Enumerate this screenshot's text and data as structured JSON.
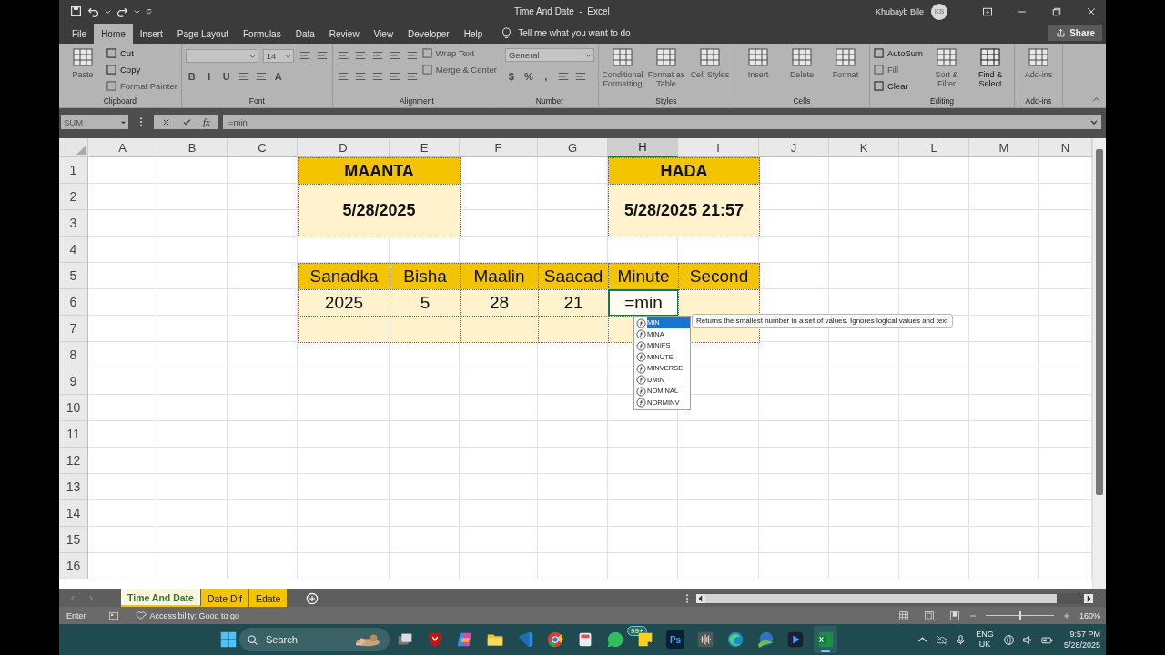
{
  "window": {
    "title": "Time And Date  -  Excel",
    "user": "Khubayb Bile",
    "avatar": "KB"
  },
  "menu_tabs": [
    {
      "label": "File",
      "selected": false
    },
    {
      "label": "Home",
      "selected": true
    },
    {
      "label": "Insert",
      "selected": false
    },
    {
      "label": "Page Layout",
      "selected": false
    },
    {
      "label": "Formulas",
      "selected": false
    },
    {
      "label": "Data",
      "selected": false
    },
    {
      "label": "Review",
      "selected": false
    },
    {
      "label": "View",
      "selected": false
    },
    {
      "label": "Developer",
      "selected": false
    },
    {
      "label": "Help",
      "selected": false
    }
  ],
  "tell_me": "Tell me what you want to do",
  "share": "Share",
  "ribbon": {
    "groups": [
      {
        "label": "Clipboard",
        "columns": [
          [
            {
              "kind": "large",
              "label": "Paste",
              "disabled": true
            }
          ],
          [
            {
              "kind": "small",
              "label": "Cut",
              "disabled": false
            },
            {
              "kind": "small",
              "label": "Copy",
              "disabled": false
            },
            {
              "kind": "small",
              "label": "Format Painter",
              "disabled": true
            }
          ]
        ]
      },
      {
        "label": "Font",
        "columns": [
          [
            {
              "kind": "row",
              "items": [
                {
                  "kind": "fontbox",
                  "disabled": true
                },
                {
                  "kind": "sizebox",
                  "label": "14",
                  "disabled": true
                },
                {
                  "kind": "tool",
                  "disabled": true
                },
                {
                  "kind": "tool",
                  "disabled": true
                }
              ]
            },
            {
              "kind": "row",
              "items": [
                {
                  "kind": "glyph",
                  "label": "B",
                  "disabled": true
                },
                {
                  "kind": "glyph",
                  "label": "I",
                  "disabled": true
                },
                {
                  "kind": "glyph",
                  "label": "U",
                  "disabled": true
                },
                {
                  "kind": "tool",
                  "disabled": true
                },
                {
                  "kind": "tool",
                  "disabled": true
                },
                {
                  "kind": "glyph",
                  "label": "A",
                  "disabled": true
                }
              ]
            }
          ]
        ]
      },
      {
        "label": "Alignment",
        "columns": [
          [
            {
              "kind": "row",
              "items": [
                {
                  "kind": "tool",
                  "disabled": true
                },
                {
                  "kind": "tool",
                  "disabled": true
                },
                {
                  "kind": "tool",
                  "disabled": true
                },
                {
                  "kind": "tool",
                  "disabled": true
                },
                {
                  "kind": "tool",
                  "disabled": true
                }
              ]
            },
            {
              "kind": "row",
              "items": [
                {
                  "kind": "tool",
                  "disabled": true
                },
                {
                  "kind": "tool",
                  "disabled": true
                },
                {
                  "kind": "tool",
                  "disabled": true
                },
                {
                  "kind": "tool",
                  "disabled": true
                },
                {
                  "kind": "tool",
                  "disabled": true
                }
              ]
            }
          ],
          [
            {
              "kind": "small",
              "label": "Wrap Text",
              "disabled": true
            },
            {
              "kind": "small",
              "label": "Merge & Center",
              "disabled": true
            }
          ]
        ]
      },
      {
        "label": "Number",
        "columns": [
          [
            {
              "kind": "formatbox",
              "label": "General",
              "disabled": true
            },
            {
              "kind": "row",
              "items": [
                {
                  "kind": "glyph",
                  "label": "$",
                  "disabled": true
                },
                {
                  "kind": "glyph",
                  "label": "%",
                  "disabled": true
                },
                {
                  "kind": "glyph",
                  "label": ",",
                  "disabled": true
                },
                {
                  "kind": "tool",
                  "disabled": true
                },
                {
                  "kind": "tool",
                  "disabled": true
                }
              ]
            }
          ]
        ]
      },
      {
        "label": "Styles",
        "columns": [
          [
            {
              "kind": "large",
              "label": "Conditional Formatting",
              "disabled": true
            }
          ],
          [
            {
              "kind": "large",
              "label": "Format as Table",
              "disabled": true
            }
          ],
          [
            {
              "kind": "large",
              "label": "Cell Styles",
              "disabled": true
            }
          ]
        ]
      },
      {
        "label": "Cells",
        "columns": [
          [
            {
              "kind": "large",
              "label": "Insert",
              "disabled": true
            }
          ],
          [
            {
              "kind": "large",
              "label": "Delete",
              "disabled": true
            }
          ],
          [
            {
              "kind": "large",
              "label": "Format",
              "disabled": true
            }
          ]
        ]
      },
      {
        "label": "Editing",
        "columns": [
          [
            {
              "kind": "small",
              "label": "AutoSum",
              "disabled": false
            },
            {
              "kind": "small",
              "label": "Fill",
              "disabled": true
            },
            {
              "kind": "small",
              "label": "Clear",
              "disabled": false
            }
          ],
          [
            {
              "kind": "large",
              "label": "Sort & Filter",
              "disabled": true
            }
          ],
          [
            {
              "kind": "large",
              "label": "Find & Select",
              "disabled": false
            }
          ]
        ]
      },
      {
        "label": "Add-ins",
        "columns": [
          [
            {
              "kind": "large",
              "label": "Add-ins",
              "disabled": true
            }
          ]
        ]
      }
    ]
  },
  "formula_bar": {
    "name_box": "SUM",
    "function_label": "fx",
    "formula": "=min"
  },
  "sheet": {
    "columns": [
      {
        "label": "A",
        "selected": false
      },
      {
        "label": "B",
        "selected": false
      },
      {
        "label": "C",
        "selected": false
      },
      {
        "label": "D",
        "selected": false
      },
      {
        "label": "E",
        "selected": false
      },
      {
        "label": "F",
        "selected": false
      },
      {
        "label": "G",
        "selected": false
      },
      {
        "label": "H",
        "selected": true
      },
      {
        "label": "I",
        "selected": false
      },
      {
        "label": "J",
        "selected": false
      },
      {
        "label": "K",
        "selected": false
      },
      {
        "label": "L",
        "selected": false
      },
      {
        "label": "M",
        "selected": false
      },
      {
        "label": "N",
        "selected": false
      }
    ],
    "rows": [
      {
        "label": "1",
        "cells": [
          {
            "kind": "empty"
          },
          {
            "kind": "empty"
          },
          {
            "kind": "empty"
          },
          {
            "kind": "header",
            "bold": true,
            "text": "MAANTA",
            "editing": false
          },
          {
            "kind": "covered"
          },
          {
            "kind": "empty"
          },
          {
            "kind": "empty"
          },
          {
            "kind": "header",
            "bold": true,
            "text": "HADA",
            "editing": false
          },
          {
            "kind": "covered"
          }
        ]
      },
      {
        "label": "2",
        "cells": [
          {
            "kind": "empty"
          },
          {
            "kind": "empty"
          },
          {
            "kind": "empty"
          },
          {
            "kind": "value",
            "bold": true,
            "text": "5/28/2025",
            "editing": false
          },
          {
            "kind": "covered"
          },
          {
            "kind": "empty"
          },
          {
            "kind": "empty"
          },
          {
            "kind": "value",
            "bold": true,
            "text": "5/28/2025 21:57",
            "editing": false
          },
          {
            "kind": "covered"
          }
        ]
      },
      {
        "label": "3",
        "cells": [
          {
            "kind": "empty"
          },
          {
            "kind": "empty"
          },
          {
            "kind": "empty"
          },
          {
            "kind": "covered"
          },
          {
            "kind": "covered"
          },
          {
            "kind": "empty"
          },
          {
            "kind": "empty"
          },
          {
            "kind": "covered"
          },
          {
            "kind": "covered"
          }
        ]
      },
      {
        "label": "4"
      },
      {
        "label": "5",
        "cells": [
          {
            "kind": "empty"
          },
          {
            "kind": "empty"
          },
          {
            "kind": "empty"
          },
          {
            "kind": "header",
            "bold": false,
            "text": "Sanadka",
            "editing": false
          },
          {
            "kind": "header",
            "bold": false,
            "text": "Bisha",
            "editing": false
          },
          {
            "kind": "header",
            "bold": false,
            "text": "Maalin",
            "editing": false
          },
          {
            "kind": "header",
            "bold": false,
            "text": "Saacad",
            "editing": false
          },
          {
            "kind": "header",
            "bold": false,
            "text": "Minute",
            "editing": false
          },
          {
            "kind": "header",
            "bold": false,
            "text": "Second",
            "editing": false
          }
        ]
      },
      {
        "label": "6",
        "cells": [
          {
            "kind": "empty"
          },
          {
            "kind": "empty"
          },
          {
            "kind": "empty"
          },
          {
            "kind": "value",
            "bold": false,
            "text": "2025",
            "editing": false
          },
          {
            "kind": "value",
            "bold": false,
            "text": "5",
            "editing": false
          },
          {
            "kind": "value",
            "bold": false,
            "text": "28",
            "editing": false
          },
          {
            "kind": "value",
            "bold": false,
            "text": "21",
            "editing": false
          },
          {
            "kind": "value",
            "bold": false,
            "text": "=min",
            "editing": true
          },
          {
            "kind": "value",
            "editing": false
          }
        ]
      },
      {
        "label": "7",
        "cells": [
          {
            "kind": "empty"
          },
          {
            "kind": "empty"
          },
          {
            "kind": "empty"
          },
          {
            "kind": "value",
            "editing": false
          },
          {
            "kind": "value",
            "editing": false
          },
          {
            "kind": "value",
            "editing": false
          },
          {
            "kind": "value",
            "editing": false
          },
          {
            "kind": "value",
            "editing": false
          },
          {
            "kind": "value",
            "editing": false
          }
        ]
      },
      {
        "label": "8"
      },
      {
        "label": "9"
      },
      {
        "label": "10"
      },
      {
        "label": "11"
      },
      {
        "label": "12"
      },
      {
        "label": "13"
      },
      {
        "label": "14"
      },
      {
        "label": "15"
      },
      {
        "label": "16"
      }
    ]
  },
  "autocomplete": {
    "items": [
      {
        "label": "MIN",
        "selected": true
      },
      {
        "label": "MINA",
        "selected": false
      },
      {
        "label": "MINIFS",
        "selected": false
      },
      {
        "label": "MINUTE",
        "selected": false
      },
      {
        "label": "MINVERSE",
        "selected": false
      },
      {
        "label": "DMIN",
        "selected": false
      },
      {
        "label": "NOMINAL",
        "selected": false
      },
      {
        "label": "NORMINV",
        "selected": false
      }
    ],
    "tooltip": "Returns the smallest number in a set of values. Ignores logical values and text"
  },
  "sheet_tabs": [
    {
      "label": "Time And Date",
      "selected": true
    },
    {
      "label": "Date Dif",
      "selected": false
    },
    {
      "label": "Edate",
      "selected": false
    }
  ],
  "status_bar": {
    "mode": "Enter",
    "accessibility": "Accessibility: Good to go",
    "zoom": {
      "level": 0.5,
      "reading": "160%"
    }
  },
  "taskbar": {
    "search": "Search",
    "apps": [
      {
        "kind": "taskview",
        "active": false
      },
      {
        "kind": "shield",
        "active": false
      },
      {
        "kind": "sparkle",
        "active": false
      },
      {
        "kind": "folder",
        "active": false
      },
      {
        "kind": "editor",
        "active": false
      },
      {
        "kind": "browser",
        "active": false
      },
      {
        "kind": "generic",
        "active": false
      },
      {
        "kind": "chat",
        "active": false,
        "badge": "99+"
      },
      {
        "kind": "note",
        "active": false
      },
      {
        "active": false,
        "label": "Ps"
      },
      {
        "kind": "wave",
        "active": false
      },
      {
        "kind": "edge",
        "active": false
      },
      {
        "kind": "download",
        "active": false
      },
      {
        "kind": "player",
        "active": false
      },
      {
        "kind": "sheet",
        "active": true
      }
    ],
    "language": "ENG UK",
    "time": "9:57 PM",
    "date": "5/28/2025"
  }
}
